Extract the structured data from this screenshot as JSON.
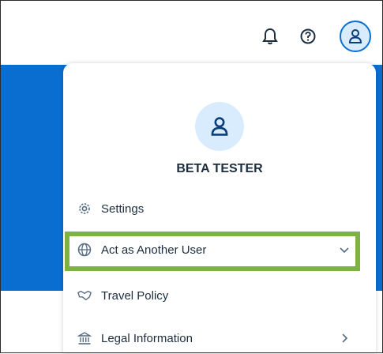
{
  "header": {
    "notifications_icon": "bell-icon",
    "help_icon": "help-circle-icon",
    "user_icon": "user-icon"
  },
  "user_menu": {
    "name": "BETA TESTER",
    "items": [
      {
        "label": "Settings",
        "icon": "gear-icon"
      },
      {
        "label": "Act as Another User",
        "icon": "globe-icon",
        "chevron": "chevron-down-icon"
      },
      {
        "label": "Travel Policy",
        "icon": "handshake-icon"
      },
      {
        "label": "Legal Information",
        "icon": "building-icon",
        "chevron": "chevron-right-icon"
      }
    ]
  },
  "colors": {
    "brand_blue": "#0a6ed1",
    "avatar_bg": "#d8ecfd",
    "highlight_green": "#7cb342"
  }
}
